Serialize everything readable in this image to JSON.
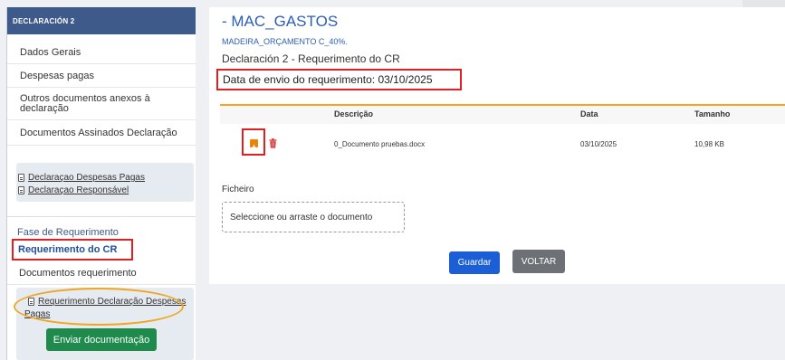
{
  "sidebar": {
    "header": "DECLARACIÓN 2",
    "items": [
      {
        "label": "Dados Gerais"
      },
      {
        "label": "Despesas pagas"
      },
      {
        "label": "Outros documentos anexos à declaração"
      },
      {
        "label": "Documentos Assinados Declaração"
      }
    ],
    "doc_links": [
      {
        "label": "Declaraçao Despesas Pagas"
      },
      {
        "label": "Declaraçao Responsável"
      }
    ],
    "phase_label": "Fase de Requerimento",
    "phase_active": "Requerimento do CR",
    "phase_item": "Documentos requerimento",
    "phase_link_line1": "Requerimento Declaração Despesas",
    "phase_link_line2": "Pagas",
    "send_button": "Enviar documentação"
  },
  "main": {
    "title": "- MAC_GASTOS",
    "subtitle": "MADEIRA_ORÇAMENTO C_40%.",
    "declaration": "Declaración 2 - Requerimento do CR",
    "submission_date": "Data de envio do requerimento: 03/10/2025",
    "table": {
      "headers": {
        "description": "Descrição",
        "date": "Data",
        "size": "Tamanho"
      },
      "rows": [
        {
          "description": "0_Documento pruebas.docx",
          "date": "03/10/2025",
          "size": "10,98 KB"
        }
      ]
    },
    "file_label": "Ficheiro",
    "dropzone_text": "Seleccione ou arraste o documento",
    "save_button": "Guardar",
    "back_button": "VOLTAR"
  },
  "colors": {
    "accent_blue": "#2c5fb3",
    "sidebar_header": "#3d5a8a",
    "highlight_red": "#e02020",
    "highlight_orange": "#f0a61e",
    "send_green": "#1e8a4c",
    "save_blue": "#1b5ed6",
    "back_gray": "#6d7074"
  }
}
